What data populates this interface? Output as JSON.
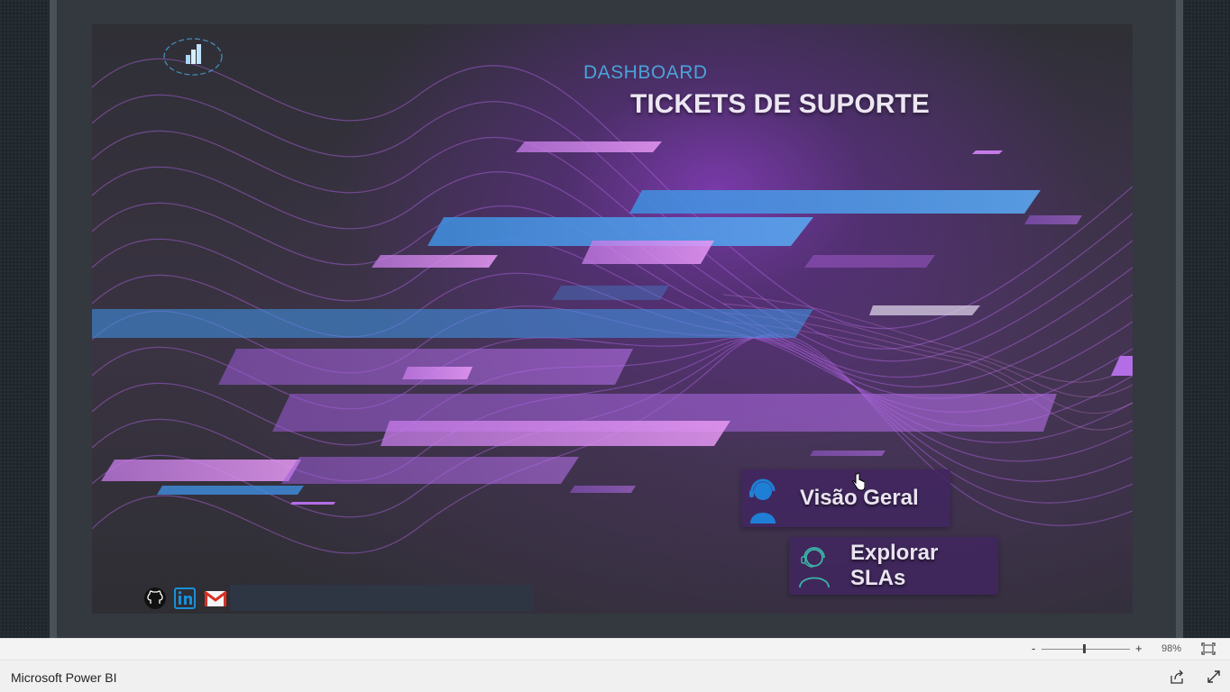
{
  "report": {
    "title_small": "DASHBOARD",
    "title_big": "TICKETS DE SUPORTE",
    "logo_icon": "bar-chart-logo-icon"
  },
  "navigation": {
    "visao_geral_label": "Visão Geral",
    "visao_geral_icon": "support-agent-icon",
    "explorar_slas_label": "Explorar SLAs",
    "explorar_slas_icon": "headset-agent-icon"
  },
  "social": {
    "icons": [
      "github-icon",
      "linkedin-icon",
      "gmail-icon"
    ]
  },
  "zoom": {
    "minus": "-",
    "plus": "+",
    "level": "98%",
    "slider_fraction": 0.5
  },
  "footer": {
    "brand": "Microsoft Power BI"
  },
  "colors": {
    "accent_blue": "#4aa3d8",
    "button_bg": "#41265f",
    "title_text": "#ece6f2",
    "canvas_purple": "#8c3cc8"
  }
}
